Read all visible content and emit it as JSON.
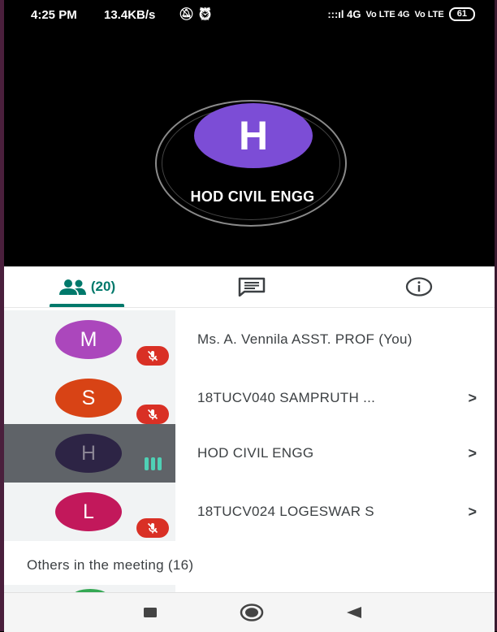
{
  "status_bar": {
    "time": "4:25 PM",
    "net_speed": "13.4KB/s",
    "left_icons": [
      "notifications-off-icon",
      "alarm-icon"
    ],
    "signal": ":::ıl 4G",
    "network_1": "Vo LTE 4G",
    "network_2": "Vo LTE",
    "battery": "61"
  },
  "stage": {
    "avatar_letter": "H",
    "avatar_color": "#7c4dd6",
    "name": "HOD CIVIL ENGG"
  },
  "tabs": {
    "people_count": "(20)",
    "people_icon": "people-icon",
    "chat_icon": "chat-icon",
    "info_icon": "info-icon",
    "accent": "#00796b"
  },
  "participants": [
    {
      "letter": "M",
      "color": "#ab47bc",
      "name": "Ms. A. Vennila ASST. PROF (You)",
      "status": "muted",
      "chevron": ""
    },
    {
      "letter": "S",
      "color": "#d84315",
      "name": "18TUCV040 SAMPRUTH ...",
      "status": "muted",
      "chevron": ">"
    },
    {
      "letter": "H",
      "color": "#2d2445",
      "name": "HOD CIVIL ENGG",
      "status": "speaking",
      "chevron": ">"
    },
    {
      "letter": "L",
      "color": "#c2185b",
      "name": "18TUCV024 LOGESWAR S",
      "status": "muted",
      "chevron": ">"
    }
  ],
  "others_section": "Others in the meeting (16)",
  "nav": {
    "recent_icon": "square-icon",
    "home_icon": "circle-icon",
    "back_icon": "triangle-back-icon"
  }
}
